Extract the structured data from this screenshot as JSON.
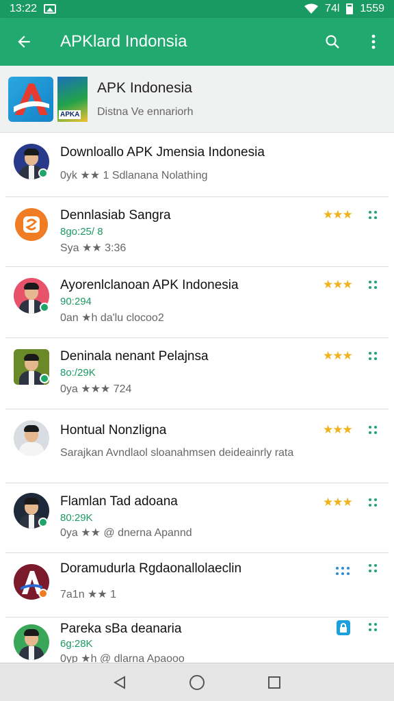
{
  "status_bar": {
    "time": "13:22",
    "signal": "74l",
    "clock_right": "1559"
  },
  "app_bar": {
    "title": "APKlard Indonsia"
  },
  "featured": {
    "title": "APK Indonesia",
    "subtitle": "Distna Ve ennariorh",
    "logo_label": "APKA"
  },
  "items": [
    {
      "title": "Downloallo APK Jmensia Indonesia",
      "line2": "",
      "line3": "0yk ★★ 1 Sdlanana Nolathing",
      "rating": "",
      "action": "none",
      "avatar_bg": "#2a3a8a",
      "badge": "#1fa56a"
    },
    {
      "title": "Dennlasiab Sangra",
      "line2": "8go:25/ 8",
      "line3": "Sya ★★ 3:36",
      "rating": "★★★",
      "action": "grid",
      "avatar_bg": "#f07d24",
      "badge": ""
    },
    {
      "title": "Ayorenlclanoan APK Indonesia",
      "line2": "90:294",
      "line3": "0an ★h da'lu clocoo2",
      "rating": "★★★",
      "action": "grid",
      "avatar_bg": "#e8536b",
      "badge": "#1fa56a"
    },
    {
      "title": "Deninala nenant Pelajnsa",
      "line2": "8o:/29K",
      "line3": "0ya ★★★ 724",
      "rating": "★★★",
      "action": "grid",
      "avatar_bg": "#6a8a2a",
      "badge": "#1fa56a"
    },
    {
      "title": "Hontual Nonzligna",
      "line2": "",
      "line3": "Sarajkan Avndlaol sloanahmsen deideainrly rata",
      "rating": "★★★",
      "action": "grid",
      "avatar_bg": "#d9dde2",
      "badge": ""
    },
    {
      "title": "Flamlan Tad adoana",
      "line2": "80:29K",
      "line3": "0ya ★★ @ dnerna Apannd",
      "rating": "★★★",
      "action": "grid",
      "avatar_bg": "#1e2a3a",
      "badge": "#1fa56a"
    },
    {
      "title": "Doramudurla Rgdaonallolaeclin",
      "line2": "",
      "line3": "7a1n ★★ 1",
      "rating": "",
      "action": "dots6",
      "avatar_bg": "#7a1a2a",
      "badge": "#f07d24"
    },
    {
      "title": "Pareka sBa deanaria",
      "line2": "6g:28K",
      "line3": "0yp ★h @ dlarna Apaooo",
      "rating": "",
      "action": "lock",
      "avatar_bg": "#3aa65a",
      "badge": ""
    }
  ],
  "colors": {
    "primary": "#21a96f",
    "status": "#1a9a63",
    "star": "#f0b21b"
  },
  "icons": [
    "back-arrow-icon",
    "search-icon",
    "more-vert-icon",
    "nav-back-icon",
    "nav-home-icon",
    "nav-recents-icon"
  ]
}
